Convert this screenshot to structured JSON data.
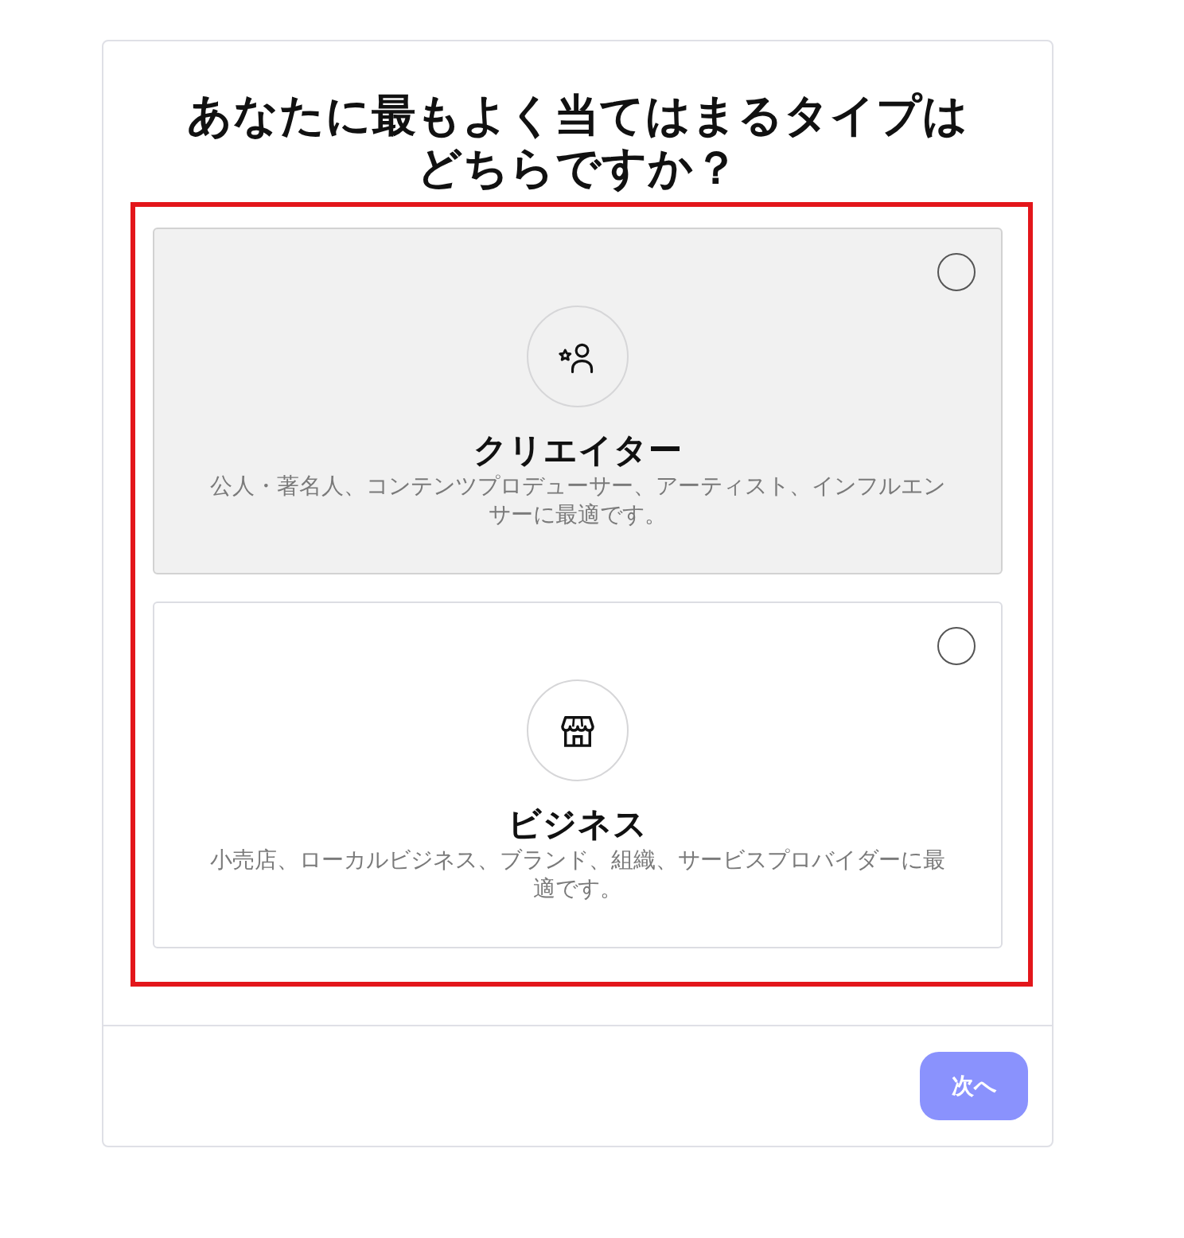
{
  "title": "あなたに最もよく当てはまるタイプはどちらですか？",
  "options_outlined": true,
  "options": [
    {
      "kind": "creator",
      "title": "クリエイター",
      "description": "公人・著名人、コンテンツプロデューサー、アーティスト、インフルエンサーに最適です。",
      "hovered": true,
      "selected": false
    },
    {
      "kind": "business",
      "title": "ビジネス",
      "description": "小売店、ローカルビジネス、ブランド、組織、サービスプロバイダーに最適です。",
      "hovered": false,
      "selected": false
    }
  ],
  "next_button": {
    "label": "次へ",
    "disabled": true
  }
}
